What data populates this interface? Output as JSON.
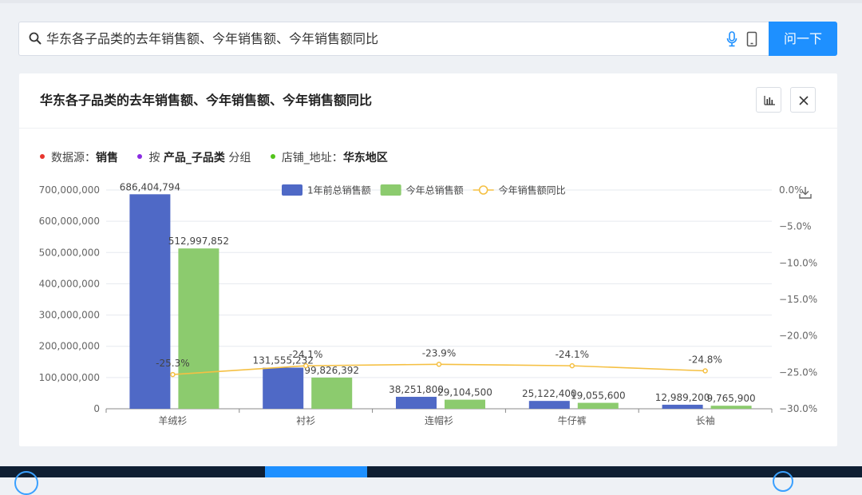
{
  "search": {
    "query": "华东各子品类的去年销售额、今年销售额、今年销售额同比",
    "ask_label": "问一下"
  },
  "card": {
    "title": "华东各子品类的去年销售额、今年销售额、今年销售额同比"
  },
  "filters": [
    {
      "color": "#e8352e",
      "prefix": "数据源：",
      "value": "销售",
      "suffix": ""
    },
    {
      "color": "#8a2be2",
      "prefix": "按 ",
      "value": "产品_子品类",
      "suffix": " 分组"
    },
    {
      "color": "#52c41a",
      "prefix": "店铺_地址：",
      "value": "华东地区",
      "suffix": ""
    }
  ],
  "chart_data": {
    "type": "bar",
    "categories": [
      "羊绒衫",
      "衬衫",
      "连帽衫",
      "牛仔裤",
      "长袖"
    ],
    "series": [
      {
        "name": "1年前总销售额",
        "kind": "bar",
        "axis": "left",
        "color": "#4f69c6",
        "values": [
          686404794,
          131555232,
          38251800,
          25122400,
          12989200
        ],
        "labels": [
          "686,404,794",
          "131,555,232",
          "38,251,800",
          "25,122,400",
          "12,989,200"
        ]
      },
      {
        "name": "今年总销售额",
        "kind": "bar",
        "axis": "left",
        "color": "#8ccb6e",
        "values": [
          512997852,
          99826392,
          29104500,
          19055600,
          9765900
        ],
        "labels": [
          "512,997,852",
          "99,826,392",
          "29,104,500",
          "19,055,600",
          "9,765,900"
        ]
      },
      {
        "name": "今年销售额同比",
        "kind": "line",
        "axis": "right",
        "color": "#f5c043",
        "values": [
          -25.3,
          -24.1,
          -23.9,
          -24.1,
          -24.8
        ],
        "labels": [
          "-25.3%",
          "-24.1%",
          "-23.9%",
          "-24.1%",
          "-24.8%"
        ]
      }
    ],
    "y_left": {
      "min": 0,
      "max": 700000000,
      "ticks": [
        "0",
        "100,000,000",
        "200,000,000",
        "300,000,000",
        "400,000,000",
        "500,000,000",
        "600,000,000",
        "700,000,000"
      ]
    },
    "y_right": {
      "min": -30,
      "max": 0,
      "ticks": [
        "−30.0%",
        "−25.0%",
        "−20.0%",
        "−15.0%",
        "−10.0%",
        "−5.0%",
        "0.0%"
      ]
    },
    "legend_position": "top-center",
    "grid": true
  }
}
